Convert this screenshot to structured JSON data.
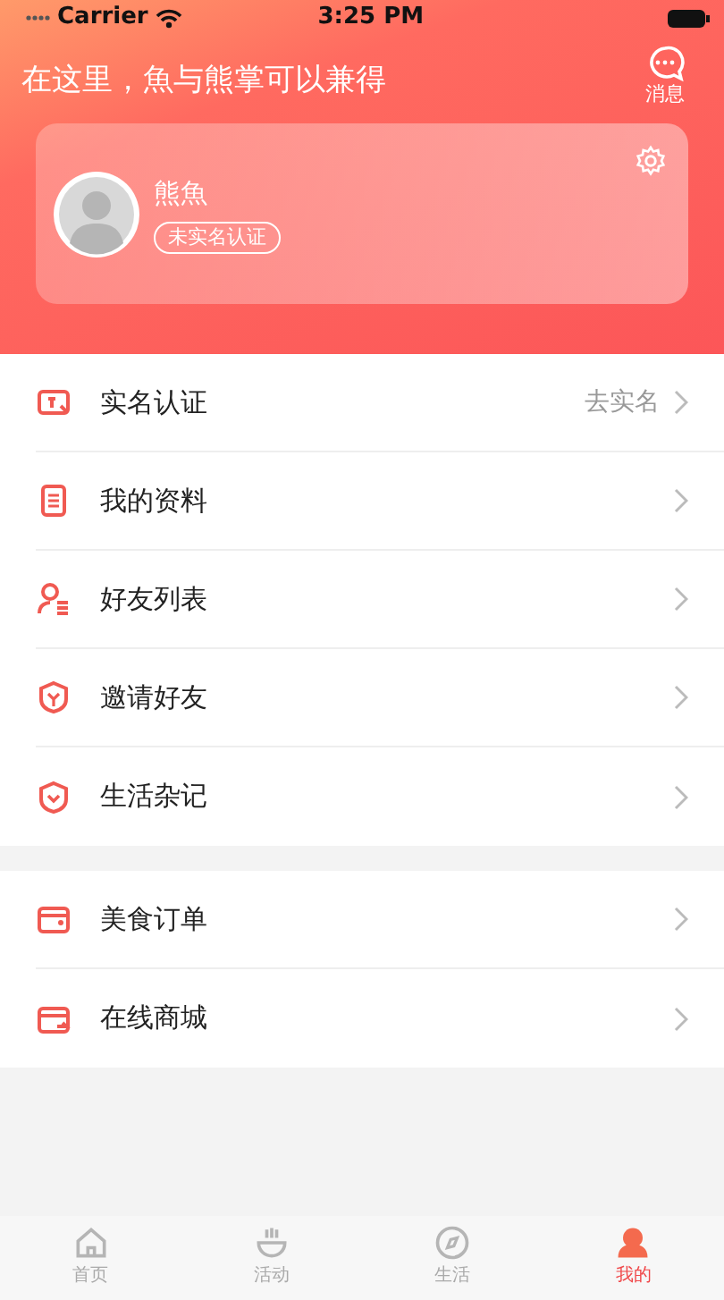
{
  "status_bar": {
    "carrier": "Carrier",
    "time": "3:25 PM"
  },
  "header": {
    "title": "在这里，魚与熊掌可以兼得",
    "message_label": "消息"
  },
  "profile": {
    "name": "熊魚",
    "badge": "未实名认证"
  },
  "menu_groups": [
    {
      "items": [
        {
          "label": "实名认证",
          "value": "去实名"
        },
        {
          "label": "我的资料"
        },
        {
          "label": "好友列表"
        },
        {
          "label": "邀请好友"
        },
        {
          "label": "生活杂记"
        }
      ]
    },
    {
      "items": [
        {
          "label": "美食订单"
        },
        {
          "label": "在线商城"
        }
      ]
    }
  ],
  "tab_bar": [
    {
      "label": "首页",
      "selected": false
    },
    {
      "label": "活动",
      "selected": false
    },
    {
      "label": "生活",
      "selected": false
    },
    {
      "label": "我的",
      "selected": true
    }
  ]
}
